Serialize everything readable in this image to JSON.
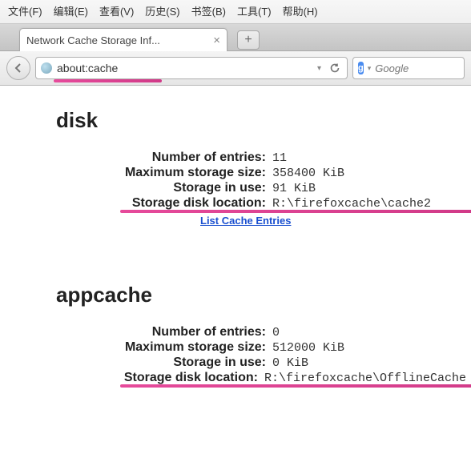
{
  "menus": [
    "文件(F)",
    "编辑(E)",
    "查看(V)",
    "历史(S)",
    "书签(B)",
    "工具(T)",
    "帮助(H)"
  ],
  "tab": {
    "title": "Network Cache Storage Inf..."
  },
  "url": "about:cache",
  "search": {
    "engine_letter": "g",
    "placeholder": "Google"
  },
  "sections": {
    "disk": {
      "heading": "disk",
      "entries_label": "Number of entries:",
      "entries": "11",
      "max_label": "Maximum storage size:",
      "max": "358400 KiB",
      "inuse_label": "Storage in use:",
      "inuse": "91 KiB",
      "loc_label": "Storage disk location:",
      "loc": "R:\\firefoxcache\\cache2",
      "link": "List Cache Entries"
    },
    "appcache": {
      "heading": "appcache",
      "entries_label": "Number of entries:",
      "entries": "0",
      "max_label": "Maximum storage size:",
      "max": "512000 KiB",
      "inuse_label": "Storage in use:",
      "inuse": "0 KiB",
      "loc_label": "Storage disk location:",
      "loc": "R:\\firefoxcache\\OfflineCache"
    }
  }
}
